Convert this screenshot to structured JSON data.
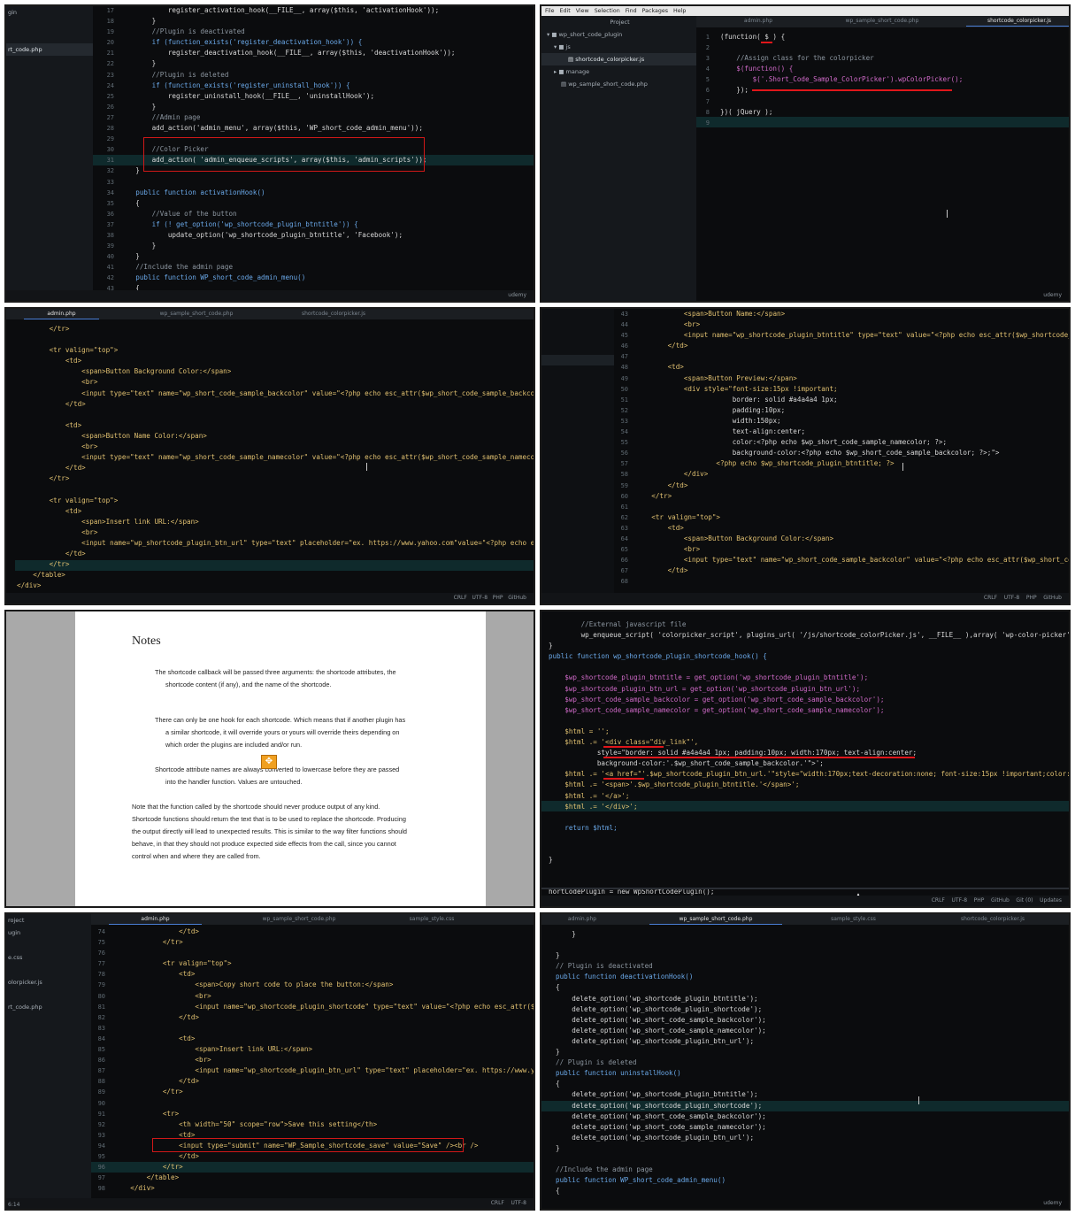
{
  "p1": {
    "side": [
      "gin",
      "rt_code.php"
    ],
    "lines": [
      "17",
      "18",
      "19",
      "20",
      "21",
      "22",
      "23",
      "24",
      "25",
      "26",
      "27",
      "28",
      "29",
      "30",
      "31",
      "32",
      "33",
      "34",
      "35",
      "36",
      "37",
      "38",
      "39",
      "40",
      "41",
      "42",
      "43",
      "44"
    ],
    "code": [
      "            register_activation_hook(__FILE__, array($this, 'activationHook'));",
      "        }",
      "        //Plugin is deactivated",
      "        if (function_exists('register_deactivation_hook')) {",
      "            register_deactivation_hook(__FILE__, array($this, 'deactivationHook'));",
      "        }",
      "        //Plugin is deleted",
      "        if (function_exists('register_uninstall_hook')) {",
      "            register_uninstall_hook(__FILE__, 'uninstallHook');",
      "        }",
      "        //Admin page",
      "        add_action('admin_menu', array($this, 'WP_short_code_admin_menu'));",
      "",
      "        //Color Picker",
      "        add_action( 'admin_enqueue_scripts', array($this, 'admin_scripts'));",
      "    }",
      "",
      "    public function activationHook()",
      "    {",
      "        //Value of the button",
      "        if (! get_option('wp_shortcode_plugin_btntitle')) {",
      "            update_option('wp_shortcode_plugin_btntitle', 'Facebook');",
      "        }",
      "    }",
      "    //Include the admin page",
      "    public function WP_short_code_admin_menu()",
      "    {",
      "        add_options_page('WP Short Code Plugin', 'WP Short Code setting', 'manage_options', 'WP Sho"
    ],
    "status": "udemy"
  },
  "p2": {
    "menu": "File   Edit   View   Selection   Find   Packages   Help",
    "project_label": "Project",
    "tabs": [
      "admin.php",
      "wp_sample_short_code.php",
      "shortcode_colorpicker.js"
    ],
    "tree": [
      "wp_short_code_plugin",
      "js",
      "shortcode_colorpicker.js",
      "manage",
      "wp_sample_short_code.php"
    ],
    "lines": [
      "1",
      "2",
      "3",
      "4",
      "5",
      "6",
      "7",
      "8",
      "9"
    ],
    "code": [
      "(function( $ ) {",
      "",
      "    //Assign class for the colorpicker",
      "    $(function() {",
      "        $('.Short_Code_Sample_ColorPicker').wpColorPicker();",
      "    });",
      "",
      "})( jQuery );",
      ""
    ],
    "status": "udemy"
  },
  "p3": {
    "tabs": [
      "admin.php",
      "wp_sample_short_code.php",
      "shortcode_colorpicker.js"
    ],
    "code": [
      "        </tr>",
      "",
      "        <tr valign=\"top\">",
      "            <td>",
      "                <span>Button Background Color:</span>",
      "                <br>",
      "                <input type=\"text\" name=\"wp_short_code_sample_backcolor\" value=\"<?php echo esc_attr($wp_short_code_sample_backcolor",
      "            </td>",
      "",
      "            <td>",
      "                <span>Button Name Color:</span>",
      "                <br>",
      "                <input type=\"text\" name=\"wp_short_code_sample_namecolor\" value=\"<?php echo esc_attr($wp_short_code_sample_namecolor",
      "            </td>",
      "        </tr>",
      "",
      "        <tr valign=\"top\">",
      "            <td>",
      "                <span>Insert link URL:</span>",
      "                <br>",
      "                <input name=\"wp_shortcode_plugin_btn_url\" type=\"text\" placeholder=\"ex. https://www.yahoo.com\"value=\"<?php echo esc_",
      "            </td>",
      "        </tr>",
      "    </table>",
      "</div>"
    ],
    "status": "CRLF   UTF-8   PHP   GitHub"
  },
  "p4": {
    "lines": [
      "43",
      "44",
      "45",
      "46",
      "47",
      "48",
      "49",
      "50",
      "51",
      "52",
      "53",
      "54",
      "55",
      "56",
      "57",
      "58",
      "59",
      "60",
      "61",
      "62",
      "63",
      "64",
      "65",
      "66",
      "67",
      "68"
    ],
    "code": [
      "            <span>Button Name:</span>",
      "            <br>",
      "            <input name=\"wp_shortcode_plugin_btntitle\" type=\"text\" value=\"<?php echo esc_attr($wp_shortcode_plu",
      "        </td>",
      "",
      "        <td>",
      "            <span>Button Preview:</span>",
      "            <div style=\"font-size:15px !important;",
      "                        border: solid #a4a4a4 1px;",
      "                        padding:10px;",
      "                        width:150px;",
      "                        text-align:center;",
      "                        color:<?php echo $wp_short_code_sample_namecolor; ?>;",
      "                        background-color:<?php echo $wp_short_code_sample_backcolor; ?>;\">",
      "                    <?php echo $wp_shortcode_plugin_btntitle; ?>",
      "            </div>",
      "        </td>",
      "    </tr>",
      "",
      "    <tr valign=\"top\">",
      "        <td>",
      "            <span>Button Background Color:</span>",
      "            <br>",
      "            <input type=\"text\" name=\"wp_short_code_sample_backcolor\" value=\"<?php echo esc_attr($wp_short_code_",
      "        </td>",
      ""
    ],
    "status": "CRLF    UTF-8    PHP    GitHub"
  },
  "p5": {
    "title": "Notes",
    "b1a": "The shortcode callback will be passed three arguments: the shortcode attributes, the",
    "b1b": "shortcode content (if any), and the name of the shortcode.",
    "b2a": "There can only be one hook for each shortcode. Which means that if another plugin has",
    "b2b": "a similar shortcode, it will override yours or yours will override theirs depending on",
    "b2c": "which order the plugins are included and/or run.",
    "b3a": "Shortcode attribute names are always converted to lowercase before they are passed",
    "b3b": "into the handler function. Values are untouched.",
    "para": [
      "Note that the function called by the shortcode should never produce output of any kind.",
      "Shortcode functions should return the text that is to be used to replace the shortcode. Producing",
      "the output directly will lead to unexpected results. This is similar to the way filter functions should",
      "behave, in that they should not produce expected side effects from the call, since you cannot",
      "control when and where they are called from."
    ]
  },
  "p6": {
    "code": [
      "        //External javascript file",
      "        wp_enqueue_script( 'colorpicker_script', plugins_url( '/js/shortcode_colorPicker.js', __FILE__ ),array( 'wp-color-picker' ),",
      "}",
      "public function wp_shortcode_plugin_shortcode_hook() {",
      "",
      "    $wp_shortcode_plugin_btntitle = get_option('wp_shortcode_plugin_btntitle');",
      "    $wp_shortcode_plugin_btn_url = get_option('wp_shortcode_plugin_btn_url');",
      "    $wp_short_code_sample_backcolor = get_option('wp_short_code_sample_backcolor');",
      "    $wp_short_code_sample_namecolor = get_option('wp_short_code_sample_namecolor');",
      "",
      "    $html = '';",
      "    $html .= '<div class=\"div_link\"',",
      "            style=\"border: solid #a4a4a4 1px; padding:10px; width:170px; text-align:center;",
      "            background-color:'.$wp_short_code_sample_backcolor.'\">';",
      "    $html .= '<a href=\"'.$wp_shortcode_plugin_btn_url.'\"style=\"width:170px;text-decoration:none; font-size:15px !important;color:'.$",
      "    $html .= '<span>'.$wp_shortcode_plugin_btntitle.'</span>';",
      "    $html .= '</a>';",
      "    $html .= '</div>';",
      "",
      "    return $html;",
      "",
      "",
      "}",
      "",
      "",
      "hortCodePlugin = new WpShortCodePlugin();"
    ],
    "status": "CRLF    UTF-8    PHP    GitHub    Git (0)    Updates"
  },
  "p7": {
    "tabs": [
      "admin.php",
      "wp_sample_short_code.php",
      "sample_style.css"
    ],
    "side": [
      "roject",
      "ugin",
      "e.css",
      "olorpicker.js",
      "rt_code.php"
    ],
    "lines": [
      "74",
      "75",
      "76",
      "77",
      "78",
      "79",
      "80",
      "81",
      "82",
      "83",
      "84",
      "85",
      "86",
      "87",
      "88",
      "89",
      "90",
      "91",
      "92",
      "93",
      "94",
      "95",
      "96",
      "97",
      "98"
    ],
    "code": [
      "                </td>",
      "            </tr>",
      "",
      "            <tr valign=\"top\">",
      "                <td>",
      "                    <span>Copy short code to place the button:</span>",
      "                    <br>",
      "                    <input name=\"wp_shortcode_plugin_shortcode\" type=\"text\" value=\"<?php echo esc_attr($wp_sh",
      "                </td>",
      "",
      "                <td>",
      "                    <span>Insert link URL:</span>",
      "                    <br>",
      "                    <input name=\"wp_shortcode_plugin_btn_url\" type=\"text\" placeholder=\"ex. https://www.yahoo.c",
      "                </td>",
      "            </tr>",
      "",
      "            <tr>",
      "                <th width=\"50\" scope=\"row\">Save this setting</th>",
      "                <td>",
      "                <input type=\"submit\" name=\"WP_Sample_shortcode_save\" value=\"Save\" /><br />",
      "                </td>",
      "            </tr>",
      "        </table>",
      "    </div>"
    ],
    "status": "CRLF    UTF-8",
    "pos": "6:14"
  },
  "p8": {
    "tabs": [
      "admin.php",
      "wp_sample_short_code.php",
      "sample_style.css",
      "shortcode_colorpicker.js"
    ],
    "code": [
      "    }",
      "",
      "}",
      "// Plugin is deactivated",
      "public function deactivationHook()",
      "{",
      "    delete_option('wp_shortcode_plugin_btntitle');",
      "    delete_option('wp_shortcode_plugin_shortcode');",
      "    delete_option('wp_short_code_sample_backcolor');",
      "    delete_option('wp_short_code_sample_namecolor');",
      "    delete_option('wp_shortcode_plugin_btn_url');",
      "}",
      "// Plugin is deleted",
      "public function uninstallHook()",
      "{",
      "    delete_option('wp_shortcode_plugin_btntitle');",
      "    delete_option('wp_shortcode_plugin_shortcode');",
      "    delete_option('wp_short_code_sample_backcolor');",
      "    delete_option('wp_short_code_sample_namecolor');",
      "    delete_option('wp_shortcode_plugin_btn_url');",
      "}",
      "",
      "//Include the admin page",
      "public function WP_short_code_admin_menu()",
      "{"
    ],
    "status": "udemy"
  },
  "colors": {
    "background": "#0b0c0e",
    "highlight_box": "#d01818",
    "keyword": "#6aa8e8",
    "string": "#9fd06a"
  }
}
